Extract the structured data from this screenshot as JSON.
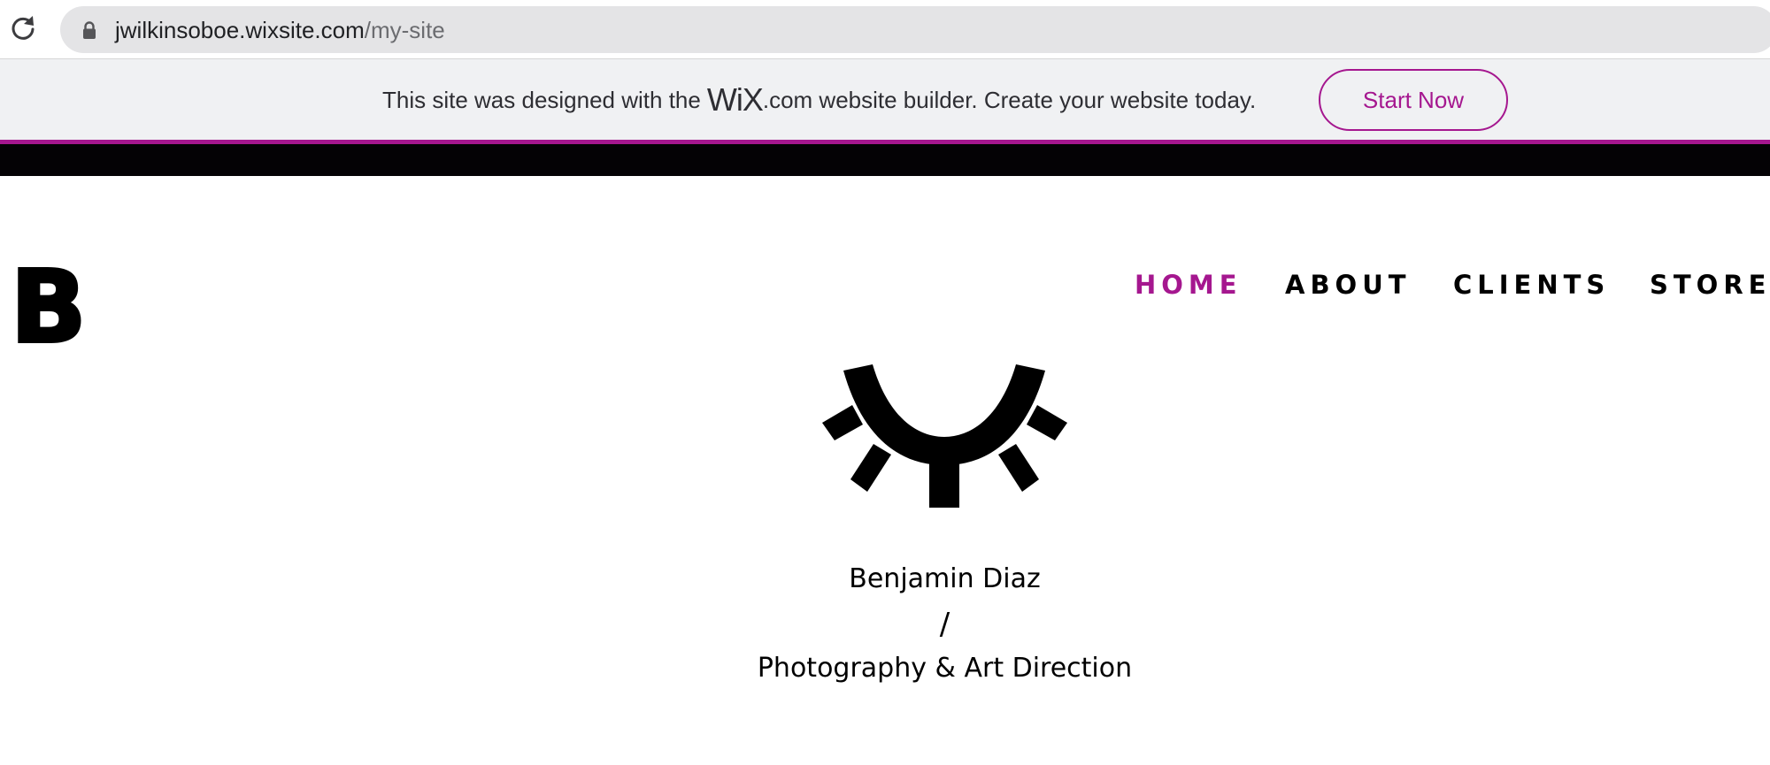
{
  "browser": {
    "url_host": "jwilkinsoboe.wixsite.com",
    "url_path": "/my-site"
  },
  "wix_banner": {
    "text_before": "This site was designed with the",
    "wix_logo": "WiX",
    "text_after": ".com website builder. Create your website today.",
    "button_label": "Start Now"
  },
  "site": {
    "logo_letter": "B",
    "nav": [
      {
        "label": "HOME",
        "active": true
      },
      {
        "label": "ABOUT",
        "active": false
      },
      {
        "label": "CLIENTS",
        "active": false
      },
      {
        "label": "STORE",
        "active": false
      }
    ],
    "hero": {
      "name": "Benjamin Diaz",
      "separator": "/",
      "role": "Photography & Art Direction"
    }
  },
  "colors": {
    "accent": "#a5178f",
    "banner_bg": "#f0f1f3",
    "black_strip": "#040205"
  },
  "icons": [
    "reload-icon",
    "lock-icon",
    "closed-eye-logo"
  ]
}
